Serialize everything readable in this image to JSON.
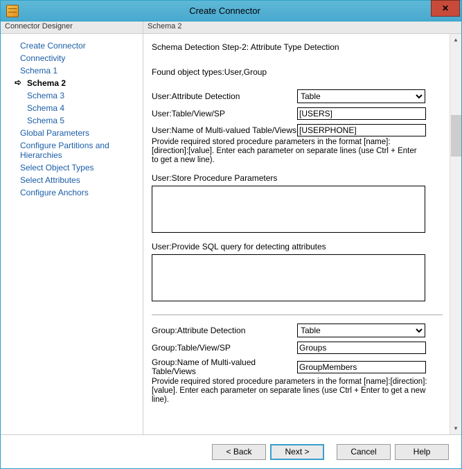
{
  "window": {
    "title": "Create Connector"
  },
  "panel_headers": {
    "left": "Connector Designer",
    "right": "Schema 2"
  },
  "nav": {
    "items": [
      {
        "label": "Create Connector",
        "indent": 0
      },
      {
        "label": "Connectivity",
        "indent": 0
      },
      {
        "label": "Schema 1",
        "indent": 0
      },
      {
        "label": "Schema 2",
        "indent": 1,
        "current": true
      },
      {
        "label": "Schema 3",
        "indent": 1
      },
      {
        "label": "Schema 4",
        "indent": 1
      },
      {
        "label": "Schema 5",
        "indent": 1
      },
      {
        "label": "Global Parameters",
        "indent": 0
      },
      {
        "label": "Configure Partitions and Hierarchies",
        "indent": 0
      },
      {
        "label": "Select Object Types",
        "indent": 0
      },
      {
        "label": "Select Attributes",
        "indent": 0
      },
      {
        "label": "Configure Anchors",
        "indent": 0
      }
    ]
  },
  "content": {
    "step_title": "Schema Detection Step-2: Attribute Type Detection",
    "found_types": "Found object types:User,Group",
    "user": {
      "attr_detection_label": "User:Attribute Detection",
      "attr_detection_value": "Table",
      "table_label": "User:Table/View/SP",
      "table_value": "[USERS]",
      "multi_label": "User:Name of Multi-valued Table/Views",
      "multi_value": "[USERPHONE]",
      "hint": "Provide required stored procedure parameters in the format [name]:[direction]:[value]. Enter each parameter on separate lines (use Ctrl + Enter to get a new line).",
      "sp_label": "User:Store Procedure Parameters",
      "sp_value": "",
      "sql_label": "User:Provide SQL query for detecting attributes",
      "sql_value": ""
    },
    "group": {
      "attr_detection_label": "Group:Attribute Detection",
      "attr_detection_value": "Table",
      "table_label": "Group:Table/View/SP",
      "table_value": "Groups",
      "multi_label": "Group:Name of Multi-valued Table/Views",
      "multi_value": "GroupMembers",
      "hint": "Provide required stored procedure parameters in the format [name]:[direction]:[value]. Enter each parameter on separate lines (use Ctrl + Enter to get a new line)."
    }
  },
  "footer": {
    "back": "<  Back",
    "next": "Next  >",
    "cancel": "Cancel",
    "help": "Help"
  }
}
